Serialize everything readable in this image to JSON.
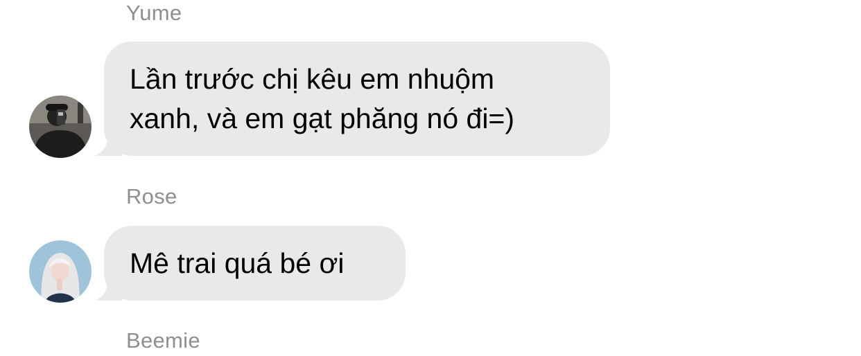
{
  "messages": [
    {
      "sender": "Yume",
      "lines": [
        "Lần trước chị kêu em nhuộm",
        "xanh, và em gạt phăng nó đi=)"
      ],
      "avatar_icon": "dark-selfie-avatar-icon"
    },
    {
      "sender": "Rose",
      "lines": [
        "Mê trai quá bé ơi"
      ],
      "avatar_icon": "blonde-portrait-avatar-icon"
    },
    {
      "sender": "Beemie"
    }
  ],
  "colors": {
    "bubble_background": "#e9e9eb",
    "sender_text": "#8e8e93",
    "message_text": "#000000",
    "page_background": "#ffffff"
  }
}
